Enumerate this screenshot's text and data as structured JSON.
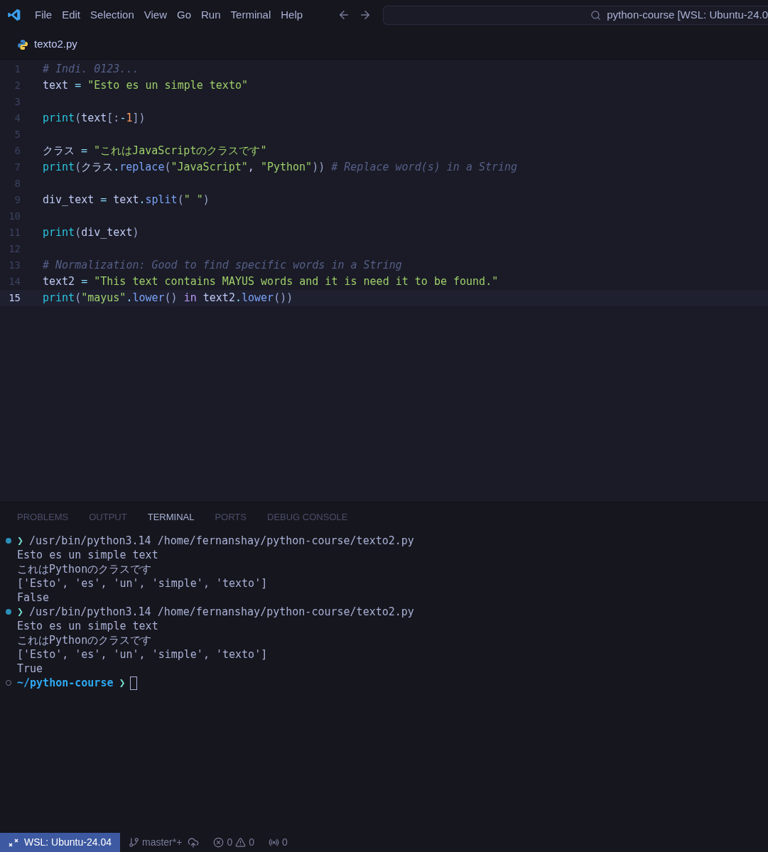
{
  "menu": [
    "File",
    "Edit",
    "Selection",
    "View",
    "Go",
    "Run",
    "Terminal",
    "Help"
  ],
  "search": {
    "value": "python-course [WSL: Ubuntu-24.0"
  },
  "tab": {
    "label": "texto2.py"
  },
  "editor": {
    "lines": [
      {
        "number": "1",
        "active": false,
        "tokens": [
          {
            "kind": "comment",
            "text": "# Indi. 0123..."
          }
        ]
      },
      {
        "number": "2",
        "active": false,
        "tokens": [
          {
            "kind": "var",
            "text": "text"
          },
          {
            "kind": "op",
            "text": " = "
          },
          {
            "kind": "string",
            "text": "\"Esto es un simple texto\""
          }
        ]
      },
      {
        "number": "3",
        "active": false
      },
      {
        "number": "4",
        "active": false,
        "tokens": [
          {
            "kind": "func",
            "text": "print"
          },
          {
            "kind": "punct",
            "text": "("
          },
          {
            "kind": "var",
            "text": "text"
          },
          {
            "kind": "punct",
            "text": "[:"
          },
          {
            "kind": "op",
            "text": "-"
          },
          {
            "kind": "number",
            "text": "1"
          },
          {
            "kind": "punct",
            "text": "])"
          }
        ]
      },
      {
        "number": "5",
        "active": false
      },
      {
        "number": "6",
        "active": false,
        "tokens": [
          {
            "kind": "var",
            "text": "クラス"
          },
          {
            "kind": "op",
            "text": " = "
          },
          {
            "kind": "string",
            "text": "\"これはJavaScriptのクラスです\""
          }
        ]
      },
      {
        "number": "7",
        "active": false,
        "tokens": [
          {
            "kind": "func",
            "text": "print"
          },
          {
            "kind": "punct",
            "text": "("
          },
          {
            "kind": "var",
            "text": "クラス"
          },
          {
            "kind": "op",
            "text": "."
          },
          {
            "kind": "method",
            "text": "replace"
          },
          {
            "kind": "punct",
            "text": "("
          },
          {
            "kind": "string",
            "text": "\"JavaScript\""
          },
          {
            "kind": "var",
            "text": ", "
          },
          {
            "kind": "string",
            "text": "\"Python\""
          },
          {
            "kind": "punct",
            "text": "))"
          },
          {
            "kind": "comment",
            "text": " # Replace word(s) in a String"
          }
        ]
      },
      {
        "number": "8",
        "active": false
      },
      {
        "number": "9",
        "active": false,
        "tokens": [
          {
            "kind": "var",
            "text": "div_text"
          },
          {
            "kind": "op",
            "text": " = "
          },
          {
            "kind": "var",
            "text": "text"
          },
          {
            "kind": "op",
            "text": "."
          },
          {
            "kind": "method",
            "text": "split"
          },
          {
            "kind": "punct",
            "text": "("
          },
          {
            "kind": "string",
            "text": "\" \""
          },
          {
            "kind": "punct",
            "text": ")"
          }
        ]
      },
      {
        "number": "10",
        "active": false
      },
      {
        "number": "11",
        "active": false,
        "tokens": [
          {
            "kind": "func",
            "text": "print"
          },
          {
            "kind": "punct",
            "text": "("
          },
          {
            "kind": "var",
            "text": "div_text"
          },
          {
            "kind": "punct",
            "text": ")"
          }
        ]
      },
      {
        "number": "12",
        "active": false
      },
      {
        "number": "13",
        "active": false,
        "tokens": [
          {
            "kind": "comment",
            "text": "# Normalization: Good to find specific words in a String"
          }
        ]
      },
      {
        "number": "14",
        "active": false,
        "tokens": [
          {
            "kind": "var",
            "text": "text2"
          },
          {
            "kind": "op",
            "text": " = "
          },
          {
            "kind": "string",
            "text": "\"This text contains MAYUS words and it is need it to be found.\""
          }
        ]
      },
      {
        "number": "15",
        "active": true,
        "tokens": [
          {
            "kind": "func",
            "text": "print"
          },
          {
            "kind": "punct",
            "text": "("
          },
          {
            "kind": "string",
            "text": "\"mayus\""
          },
          {
            "kind": "op",
            "text": "."
          },
          {
            "kind": "method",
            "text": "lower"
          },
          {
            "kind": "punct",
            "text": "()"
          },
          {
            "kind": "keyword",
            "text": " in "
          },
          {
            "kind": "var",
            "text": "text2"
          },
          {
            "kind": "op",
            "text": "."
          },
          {
            "kind": "method",
            "text": "lower"
          },
          {
            "kind": "punct",
            "text": "())"
          }
        ]
      }
    ]
  },
  "panel": {
    "tabs": [
      {
        "label": "PROBLEMS",
        "selected": false
      },
      {
        "label": "OUTPUT",
        "selected": false
      },
      {
        "label": "TERMINAL",
        "selected": true
      },
      {
        "label": "PORTS",
        "selected": false
      },
      {
        "label": "DEBUG CONSOLE",
        "selected": false
      }
    ],
    "terminal": [
      {
        "kind": "command",
        "symbol": "❯",
        "text": "/usr/bin/python3.14 /home/fernanshay/python-course/texto2.py"
      },
      {
        "kind": "output",
        "text": "Esto es un simple text"
      },
      {
        "kind": "output",
        "text": "これはPythonのクラスです"
      },
      {
        "kind": "output",
        "text": "['Esto', 'es', 'un', 'simple', 'texto']"
      },
      {
        "kind": "output",
        "text": "False"
      },
      {
        "kind": "command",
        "symbol": "❯",
        "text": "/usr/bin/python3.14 /home/fernanshay/python-course/texto2.py"
      },
      {
        "kind": "output",
        "text": "Esto es un simple text"
      },
      {
        "kind": "output",
        "text": "これはPythonのクラスです"
      },
      {
        "kind": "output",
        "text": "['Esto', 'es', 'un', 'simple', 'texto']"
      },
      {
        "kind": "output",
        "text": "True"
      },
      {
        "kind": "prompt",
        "cwd": "~/python-course",
        "symbol": "❯"
      }
    ]
  },
  "status_bar": {
    "remote": "WSL: Ubuntu-24.04",
    "branch": "master*+",
    "errors": "0",
    "warnings": "0",
    "ports": "0"
  }
}
